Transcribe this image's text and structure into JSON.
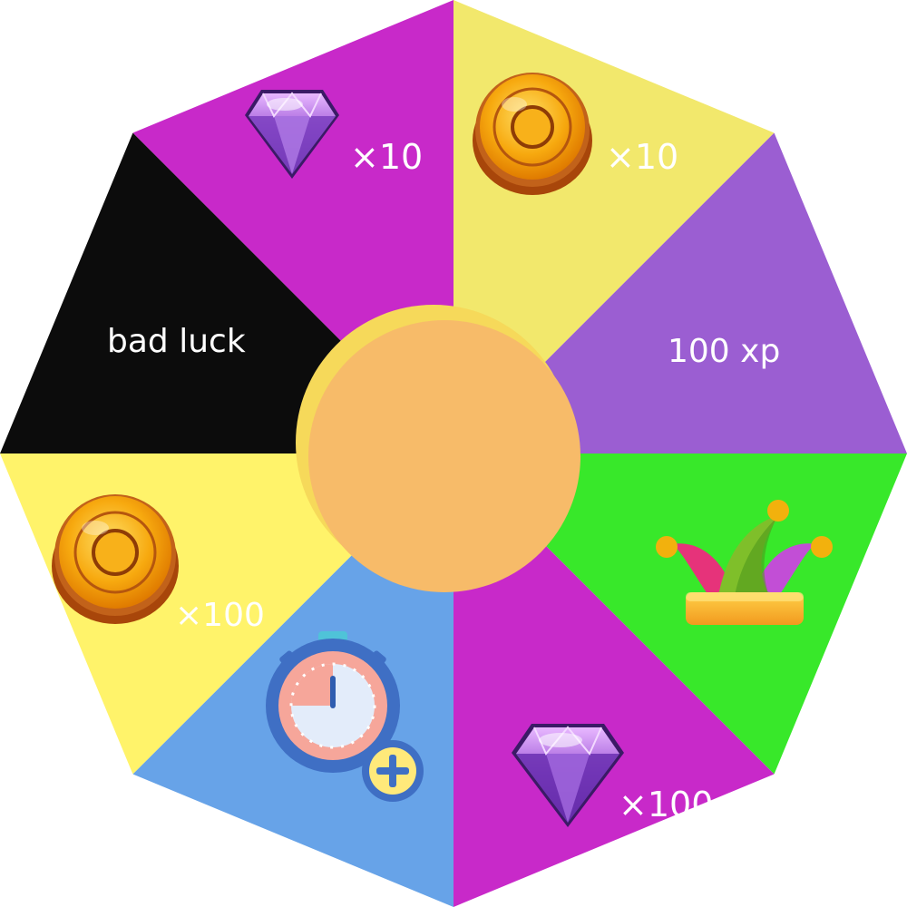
{
  "wheel": {
    "segments": [
      {
        "id": "gem-10",
        "color": "#C829C9",
        "reward_icon": "gem-icon",
        "label": "×10"
      },
      {
        "id": "coin-10",
        "color": "#F2E86C",
        "reward_icon": "coin-icon",
        "label": "×10"
      },
      {
        "id": "xp-100",
        "color": "#9B5ED2",
        "reward_icon": "",
        "label": "100 xp"
      },
      {
        "id": "jester-hat",
        "color": "#38E82A",
        "reward_icon": "jester-hat-icon",
        "label": ""
      },
      {
        "id": "gem-100",
        "color": "#C829C9",
        "reward_icon": "gem-icon",
        "label": "×100"
      },
      {
        "id": "time-bonus",
        "color": "#67A3E8",
        "reward_icon": "stopwatch-plus-icon",
        "label": ""
      },
      {
        "id": "coin-100",
        "color": "#FFF36A",
        "reward_icon": "coin-icon",
        "label": "×100"
      },
      {
        "id": "bad-luck",
        "color": "#0C0C0C",
        "reward_icon": "",
        "label": "bad luck"
      }
    ],
    "hub_color": "#F7BB69",
    "hub_shadow_color": "#F6D95A"
  }
}
